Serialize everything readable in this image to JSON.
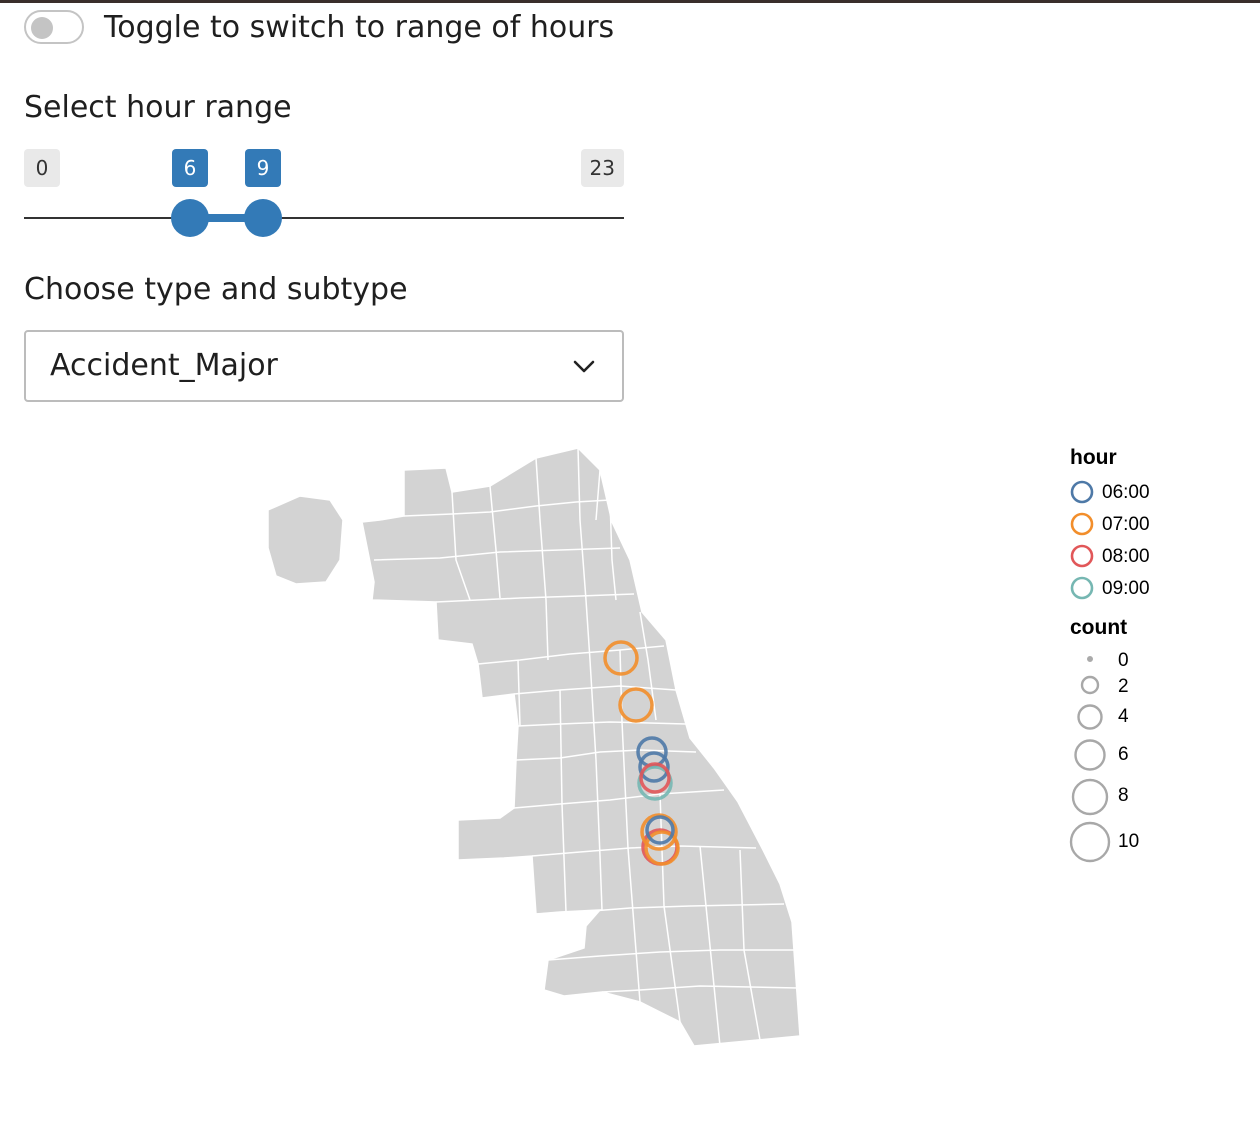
{
  "toggle": {
    "label": "Toggle to switch to range of hours",
    "on": false
  },
  "hour_range": {
    "label": "Select hour range",
    "min": "0",
    "max": "23",
    "from": "6",
    "to": "9"
  },
  "type_select": {
    "label": "Choose type and subtype",
    "value": "Accident_Major"
  },
  "legend": {
    "hour_title": "hour",
    "hours": [
      {
        "label": "06:00",
        "color": "#4e79a7"
      },
      {
        "label": "07:00",
        "color": "#f28e2b"
      },
      {
        "label": "08:00",
        "color": "#e15759"
      },
      {
        "label": "09:00",
        "color": "#76b7b2"
      }
    ],
    "count_title": "count",
    "counts": [
      "0",
      "2",
      "4",
      "6",
      "8",
      "10"
    ]
  },
  "colors": {
    "accent": "#337ab7",
    "map_fill": "#d3d3d3",
    "map_stroke": "#ffffff"
  }
}
